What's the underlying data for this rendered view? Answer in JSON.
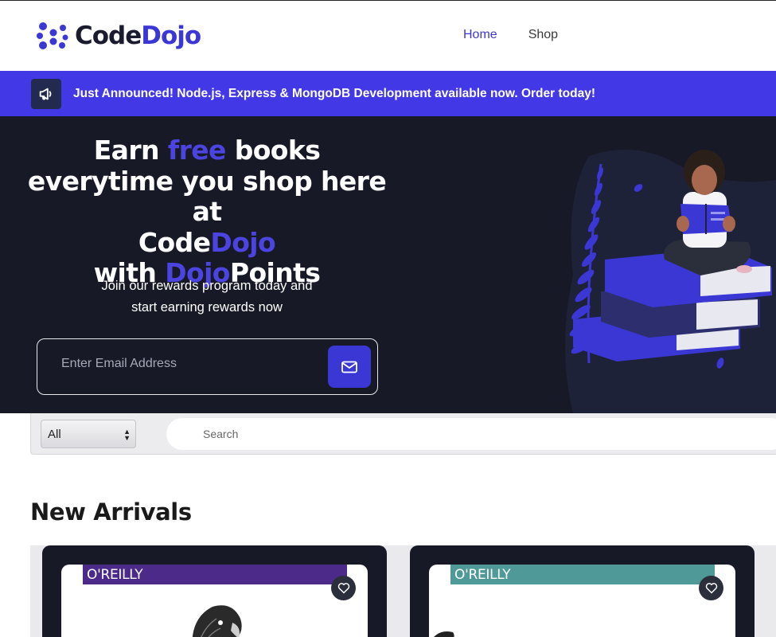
{
  "brand": {
    "name_part1": "Code",
    "name_part2": "Dojo"
  },
  "nav": {
    "home": "Home",
    "shop": "Shop"
  },
  "announcement": {
    "icon": "megaphone-icon",
    "text": "Just Announced! Node.js, Express & MongoDB Development available now. Order today!"
  },
  "hero": {
    "line1_a": "Earn ",
    "line1_b": "free",
    "line1_c": " books",
    "line2": "everytime you shop here at",
    "line3_a": "Code",
    "line3_b": "Dojo",
    "line4_a": "with ",
    "line4_b": "Dojo",
    "line4_c": "Points",
    "sub1": "Join our rewards program today and",
    "sub2": "start earning rewards now",
    "email_placeholder": "Enter Email Address",
    "submit_icon": "envelope-icon"
  },
  "search": {
    "category": "All",
    "placeholder": "Search"
  },
  "new_arrivals": {
    "title": "New Arrivals",
    "books": [
      {
        "publisher": "O'REILLY",
        "bar_color": "#4b2a8a"
      },
      {
        "publisher": "O'REILLY",
        "bar_color": "#4f9a98"
      }
    ]
  },
  "colors": {
    "accent": "#3b37d4",
    "announce_bg": "#4338e6",
    "hero_bg": "#171a26"
  }
}
